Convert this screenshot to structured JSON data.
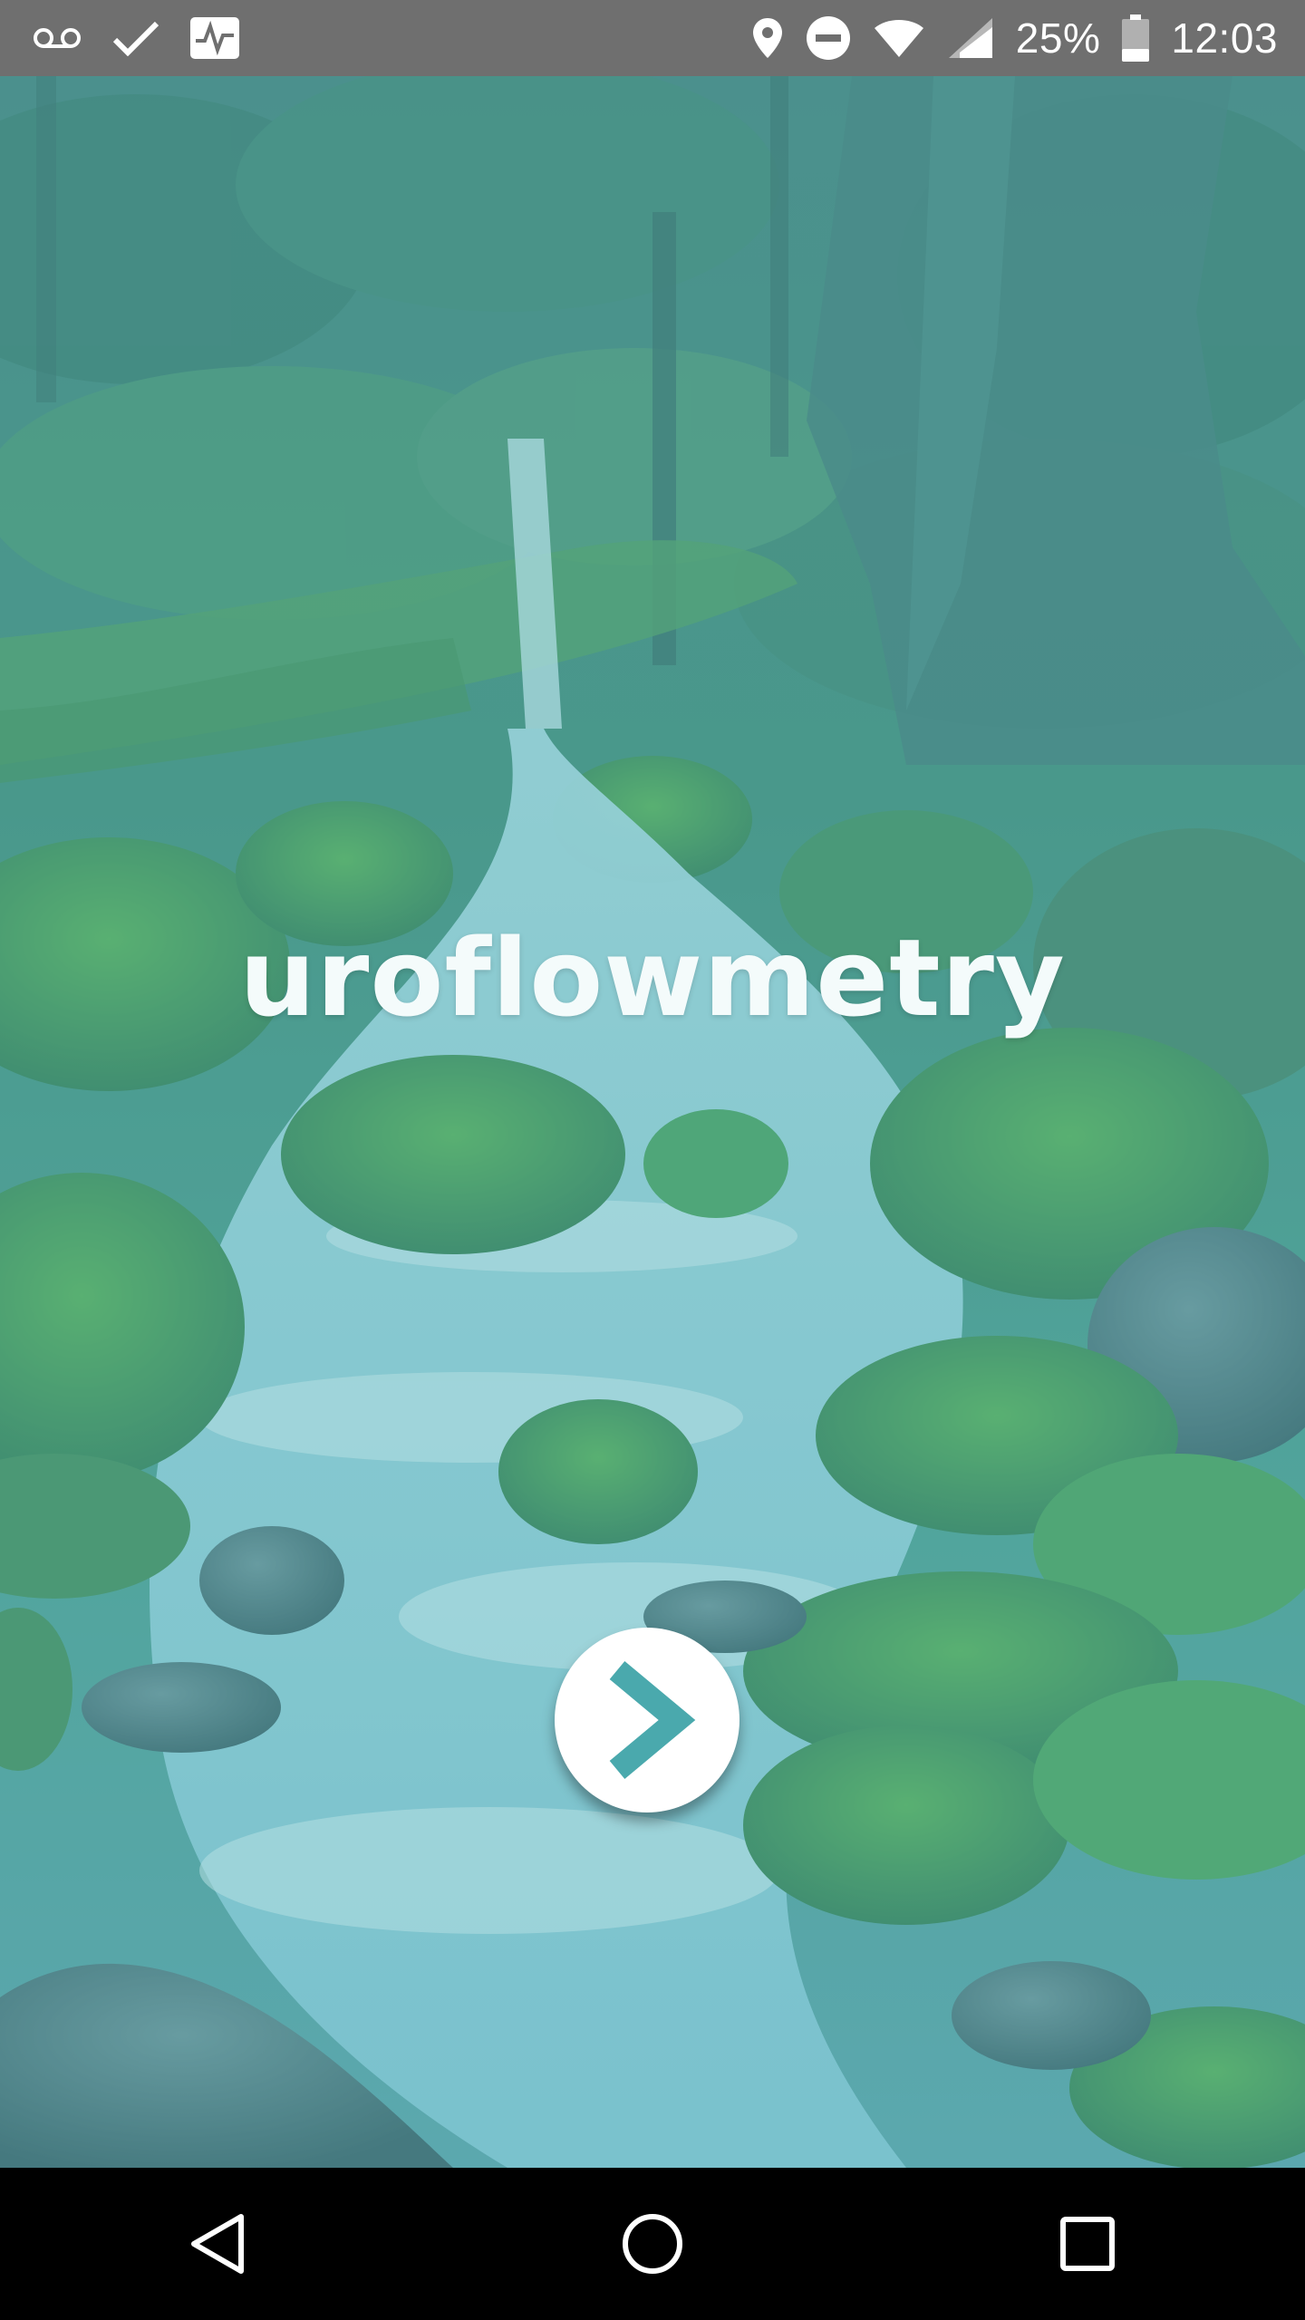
{
  "status_bar": {
    "left_icons": [
      "voicemail-icon",
      "check-icon",
      "activity-icon"
    ],
    "right_icons": [
      "location-icon",
      "do-not-disturb-icon",
      "wifi-icon",
      "cellular-icon",
      "battery-icon"
    ],
    "battery_percent": "25%",
    "time": "12:03",
    "background_color": "#6f6f6f"
  },
  "splash": {
    "title": "uroflowmetry",
    "next_button_icon": "chevron-right-icon",
    "accent_color": "#4aa9ad",
    "overlay_tint": "#5fb0b6"
  },
  "nav_bar": {
    "buttons": [
      "back-icon",
      "home-icon",
      "recents-icon"
    ]
  }
}
